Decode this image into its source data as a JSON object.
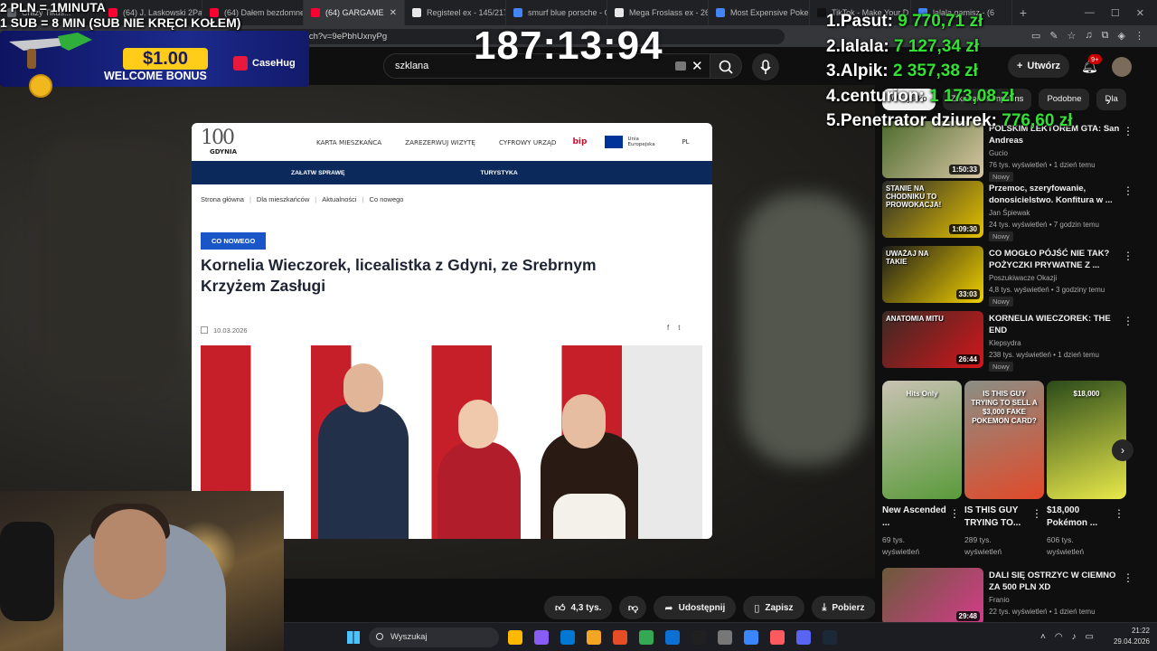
{
  "browser": {
    "tabs": [
      {
        "label": "Crazy Tikus...",
        "color": "#5f6368"
      },
      {
        "label": "(64) J. Laskowski 2Pac",
        "color": "#ff0033"
      },
      {
        "label": "(64) Dałem bezdomne",
        "color": "#ff0033"
      },
      {
        "label": "(64) GARGAME",
        "color": "#ff0033",
        "active": true
      },
      {
        "label": "Registeel ex - 145/217",
        "color": "#e8e8e8"
      },
      {
        "label": "smurf blue porsche - G",
        "color": "#4285f4"
      },
      {
        "label": "Mega Froslass ex - 26",
        "color": "#e8e8e8"
      },
      {
        "label": "Most Expensive Poken",
        "color": "#4285f4"
      },
      {
        "label": "TikTok - Make Your D",
        "color": "#111111"
      },
      {
        "label": "lalala gamisz - (6",
        "color": "#4285f4"
      }
    ],
    "url": "youtube.com/watch?v=9ePbhUxnyPg",
    "window_controls": [
      "—",
      "☐",
      "✕"
    ]
  },
  "youtube": {
    "search_value": "szklana",
    "create_label": "Utwórz",
    "notifications_badge": "9+"
  },
  "overlay": {
    "rate_line1": "2 PLN =  1MINUTA",
    "rate_line2": "1 SUB = 8 MIN (SUB NIE KRĘCI KOŁEM)",
    "timer": "187:13:9",
    "timer_extra": "4",
    "promo_amount": "$1.00",
    "promo_text": "WELCOME BONUS",
    "promo_brand": "CaseHug",
    "leaderboard": [
      {
        "rank": "1.",
        "name": "Pasut:",
        "amount": "9 770,71 zł"
      },
      {
        "rank": "2.",
        "name": "lalala:",
        "amount": "7 127,34 zł"
      },
      {
        "rank": "3.",
        "name": "Alpik:",
        "amount": "2 357,38 zł"
      },
      {
        "rank": "4.",
        "name": "centurion:",
        "amount": "1 173,08 zł"
      },
      {
        "rank": "5.",
        "name": "Penetrator dziurek:",
        "amount": "776,60 zł"
      }
    ]
  },
  "webpage": {
    "logo_number": "100",
    "logo_name": "GDYNIA",
    "nav": [
      "KARTA MIESZKAŃCA",
      "ZAREZERWUJ WIZYTĘ",
      "CYFROWY URZĄD"
    ],
    "bip": "bip",
    "eu_text": "Unia Europejska",
    "lang": "PL",
    "bar_items": [
      "ZAŁATW SPRAWĘ",
      "TURYSTYKA"
    ],
    "breadcrumbs": [
      "Strona główna",
      "Dla mieszkańców",
      "Aktualności",
      "Co nowego"
    ],
    "badge": "CO NOWEGO",
    "title": "Kornelia Wieczorek, licealistka z Gdyni, ze Srebrnym Krzyżem Zasługi",
    "date": "10.03.2026"
  },
  "actions": {
    "likes": "4,3 tys.",
    "share": "Udostępnij",
    "save": "Zapisz",
    "download": "Pobierz"
  },
  "sidebar": {
    "chips": [
      "Wszystko",
      "Z kanału Simpsons",
      "Podobne",
      "Dla"
    ],
    "videos": [
      {
        "title": "POLSKIM LEKTOREM GTA: San Andreas",
        "channel": "Gucio",
        "meta": "76 tys. wyświetleń • 1 dzień temu",
        "duration": "1:50:33",
        "badge": "Nowy",
        "colors": [
          "#4c6b2d",
          "#d9c6a4"
        ]
      },
      {
        "title": "Przemoc, szeryfowanie, donosicielstwo. Konfitura w ...",
        "channel": "Jan Śpiewak",
        "meta": "24 tys. wyświetleń • 7 godzin temu",
        "duration": "1:09:30",
        "badge": "Nowy",
        "thumb_text": "STANIE NA CHODNIKU TO PROWOKACJA!",
        "colors": [
          "#2a2a2a",
          "#e6c200"
        ]
      },
      {
        "title": "CO MOGŁO PÓJŚĆ NIE TAK? POŻYCZKI PRYWATNE Z ...",
        "channel": "Poszukiwacze Okazji",
        "meta": "4,8 tys. wyświetleń • 3 godziny temu",
        "duration": "33:03",
        "badge": "Nowy",
        "thumb_text": "UWAŻAJ NA TAKIE",
        "colors": [
          "#1a1a1a",
          "#f2d000"
        ]
      },
      {
        "title": "KORNELIA WIECZOREK: THE END",
        "channel": "Klepsydra",
        "meta": "238 tys. wyświetleń • 1 dzień temu",
        "duration": "26:44",
        "badge": "Nowy",
        "thumb_text": "ANATOMIA MITU",
        "colors": [
          "#3a2a24",
          "#d4161c"
        ]
      },
      {
        "title": "DALI SIĘ OSTRZYC W CIEMNO ZA 500 PLN XD",
        "channel": "Franio",
        "meta": "22 tys. wyświetleń • 1 dzień temu",
        "duration": "29:48",
        "colors": [
          "#6b5a3a",
          "#d43b8a"
        ]
      }
    ],
    "shorts": [
      {
        "title": "New Ascended ...",
        "views": "69 tys. wyświetleń",
        "thumb_text": "Hits Only",
        "colors": [
          "#c9c2b3",
          "#5a9a3a"
        ]
      },
      {
        "title": "IS THIS GUY TRYING TO...",
        "views": "289 tys. wyświetleń",
        "thumb_text": "IS THIS GUY TRYING TO SELL A $3,000 FAKE POKEMON CARD?",
        "colors": [
          "#8a8f85",
          "#e14a2a"
        ]
      },
      {
        "title": "$18,000 Pokémon ...",
        "views": "606 tys. wyświetleń",
        "thumb_text": "$18,000",
        "colors": [
          "#2a4a1a",
          "#e9e94a"
        ]
      }
    ]
  },
  "taskbar": {
    "search": "Wyszukaj",
    "time": "21:22",
    "date": "29.04.2026",
    "apps": [
      "#ffb900",
      "#8a5cf6",
      "#0078d4",
      "#f3a623",
      "#e44d26",
      "#34a853",
      "#0b6fd3",
      "#202020",
      "#777777",
      "#3a86ff",
      "#ff5a5f",
      "#5865f2",
      "#1b2838"
    ]
  }
}
